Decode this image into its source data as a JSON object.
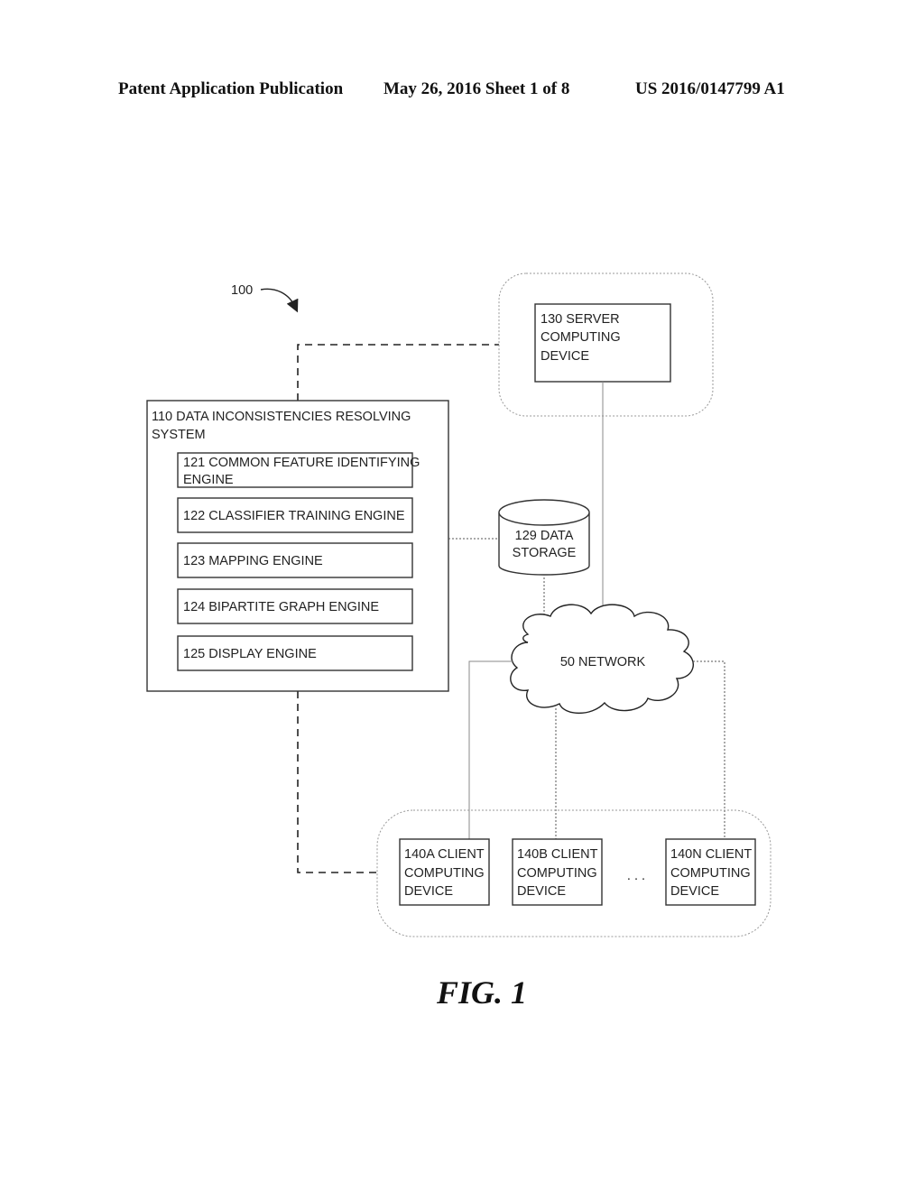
{
  "header": {
    "publication": "Patent Application Publication",
    "date_sheet": "May 26, 2016  Sheet 1 of 8",
    "number": "US 2016/0147799 A1"
  },
  "diagram": {
    "ref_label": "100",
    "system": {
      "title_line1": "110 DATA INCONSISTENCIES RESOLVING",
      "title_line2": "SYSTEM",
      "engines": [
        {
          "line1": "121 COMMON FEATURE IDENTIFYING",
          "line2": "ENGINE"
        },
        {
          "line1": "122 CLASSIFIER TRAINING ENGINE",
          "line2": ""
        },
        {
          "line1": "123 MAPPING ENGINE",
          "line2": ""
        },
        {
          "line1": "124 BIPARTITE GRAPH ENGINE",
          "line2": ""
        },
        {
          "line1": "125 DISPLAY ENGINE",
          "line2": ""
        }
      ]
    },
    "server": {
      "line1": "130 SERVER",
      "line2": "COMPUTING",
      "line3": "DEVICE"
    },
    "storage": {
      "line1": "129 DATA",
      "line2": "STORAGE"
    },
    "network": {
      "label": "50 NETWORK"
    },
    "clients": [
      {
        "line1": "140A CLIENT",
        "line2": "COMPUTING",
        "line3": "DEVICE"
      },
      {
        "line1": "140B CLIENT",
        "line2": "COMPUTING",
        "line3": "DEVICE"
      },
      {
        "line1": "140N CLIENT",
        "line2": "COMPUTING",
        "line3": "DEVICE"
      }
    ],
    "ellipsis": ". . .",
    "figure_label": "FIG. 1"
  }
}
